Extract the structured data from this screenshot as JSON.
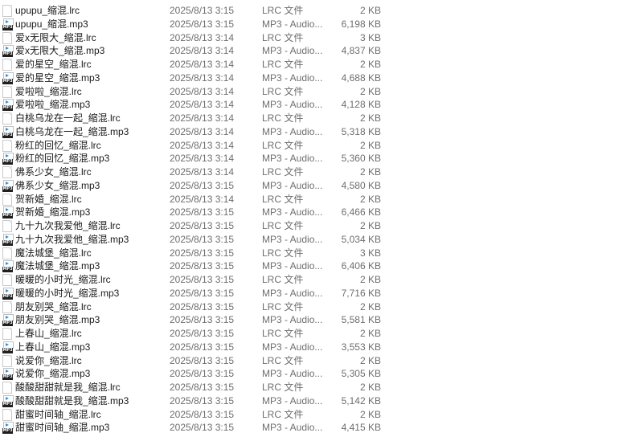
{
  "files": [
    {
      "name": "upupu_缩混.lrc",
      "date": "2025/8/13 3:15",
      "type": "LRC 文件",
      "size": "2 KB",
      "icon": "document-icon"
    },
    {
      "name": "upupu_缩混.mp3",
      "date": "2025/8/13 3:15",
      "type": "MP3 - Audio...",
      "size": "6,198 KB",
      "icon": "mp3-audio-icon"
    },
    {
      "name": "爱x无限大_缩混.lrc",
      "date": "2025/8/13 3:14",
      "type": "LRC 文件",
      "size": "3 KB",
      "icon": "document-icon"
    },
    {
      "name": "爱x无限大_缩混.mp3",
      "date": "2025/8/13 3:14",
      "type": "MP3 - Audio...",
      "size": "4,837 KB",
      "icon": "mp3-audio-icon"
    },
    {
      "name": "爱的星空_缩混.lrc",
      "date": "2025/8/13 3:14",
      "type": "LRC 文件",
      "size": "2 KB",
      "icon": "document-icon"
    },
    {
      "name": "爱的星空_缩混.mp3",
      "date": "2025/8/13 3:14",
      "type": "MP3 - Audio...",
      "size": "4,688 KB",
      "icon": "mp3-audio-icon"
    },
    {
      "name": "爱啦啦_缩混.lrc",
      "date": "2025/8/13 3:14",
      "type": "LRC 文件",
      "size": "2 KB",
      "icon": "document-icon"
    },
    {
      "name": "爱啦啦_缩混.mp3",
      "date": "2025/8/13 3:14",
      "type": "MP3 - Audio...",
      "size": "4,128 KB",
      "icon": "mp3-audio-icon"
    },
    {
      "name": "白桃乌龙在一起_缩混.lrc",
      "date": "2025/8/13 3:14",
      "type": "LRC 文件",
      "size": "2 KB",
      "icon": "document-icon"
    },
    {
      "name": "白桃乌龙在一起_缩混.mp3",
      "date": "2025/8/13 3:14",
      "type": "MP3 - Audio...",
      "size": "5,318 KB",
      "icon": "mp3-audio-icon"
    },
    {
      "name": "粉红的回忆_缩混.lrc",
      "date": "2025/8/13 3:14",
      "type": "LRC 文件",
      "size": "2 KB",
      "icon": "document-icon"
    },
    {
      "name": "粉红的回忆_缩混.mp3",
      "date": "2025/8/13 3:14",
      "type": "MP3 - Audio...",
      "size": "5,360 KB",
      "icon": "mp3-audio-icon"
    },
    {
      "name": "佛系少女_缩混.lrc",
      "date": "2025/8/13 3:14",
      "type": "LRC 文件",
      "size": "2 KB",
      "icon": "document-icon"
    },
    {
      "name": "佛系少女_缩混.mp3",
      "date": "2025/8/13 3:15",
      "type": "MP3 - Audio...",
      "size": "4,580 KB",
      "icon": "mp3-audio-icon"
    },
    {
      "name": "贺新婚_缩混.lrc",
      "date": "2025/8/13 3:14",
      "type": "LRC 文件",
      "size": "2 KB",
      "icon": "document-icon"
    },
    {
      "name": "贺新婚_缩混.mp3",
      "date": "2025/8/13 3:15",
      "type": "MP3 - Audio...",
      "size": "6,466 KB",
      "icon": "mp3-audio-icon"
    },
    {
      "name": "九十九次我爱他_缩混.lrc",
      "date": "2025/8/13 3:15",
      "type": "LRC 文件",
      "size": "2 KB",
      "icon": "document-icon"
    },
    {
      "name": "九十九次我爱他_缩混.mp3",
      "date": "2025/8/13 3:15",
      "type": "MP3 - Audio...",
      "size": "5,034 KB",
      "icon": "mp3-audio-icon"
    },
    {
      "name": "魔法城堡_缩混.lrc",
      "date": "2025/8/13 3:15",
      "type": "LRC 文件",
      "size": "3 KB",
      "icon": "document-icon"
    },
    {
      "name": "魔法城堡_缩混.mp3",
      "date": "2025/8/13 3:15",
      "type": "MP3 - Audio...",
      "size": "6,406 KB",
      "icon": "mp3-audio-icon"
    },
    {
      "name": "暖暖的小时光_缩混.lrc",
      "date": "2025/8/13 3:15",
      "type": "LRC 文件",
      "size": "2 KB",
      "icon": "document-icon"
    },
    {
      "name": "暖暖的小时光_缩混.mp3",
      "date": "2025/8/13 3:15",
      "type": "MP3 - Audio...",
      "size": "7,716 KB",
      "icon": "mp3-audio-icon"
    },
    {
      "name": "朋友别哭_缩混.lrc",
      "date": "2025/8/13 3:15",
      "type": "LRC 文件",
      "size": "2 KB",
      "icon": "document-icon"
    },
    {
      "name": "朋友别哭_缩混.mp3",
      "date": "2025/8/13 3:15",
      "type": "MP3 - Audio...",
      "size": "5,581 KB",
      "icon": "mp3-audio-icon"
    },
    {
      "name": "上春山_缩混.lrc",
      "date": "2025/8/13 3:15",
      "type": "LRC 文件",
      "size": "2 KB",
      "icon": "document-icon"
    },
    {
      "name": "上春山_缩混.mp3",
      "date": "2025/8/13 3:15",
      "type": "MP3 - Audio...",
      "size": "3,553 KB",
      "icon": "mp3-audio-icon"
    },
    {
      "name": "说爱你_缩混.lrc",
      "date": "2025/8/13 3:15",
      "type": "LRC 文件",
      "size": "2 KB",
      "icon": "document-icon"
    },
    {
      "name": "说爱你_缩混.mp3",
      "date": "2025/8/13 3:15",
      "type": "MP3 - Audio...",
      "size": "5,305 KB",
      "icon": "mp3-audio-icon"
    },
    {
      "name": "酸酸甜甜就是我_缩混.lrc",
      "date": "2025/8/13 3:15",
      "type": "LRC 文件",
      "size": "2 KB",
      "icon": "document-icon"
    },
    {
      "name": "酸酸甜甜就是我_缩混.mp3",
      "date": "2025/8/13 3:15",
      "type": "MP3 - Audio...",
      "size": "5,142 KB",
      "icon": "mp3-audio-icon"
    },
    {
      "name": "甜蜜时间轴_缩混.lrc",
      "date": "2025/8/13 3:15",
      "type": "LRC 文件",
      "size": "2 KB",
      "icon": "document-icon"
    },
    {
      "name": "甜蜜时间轴_缩混.mp3",
      "date": "2025/8/13 3:15",
      "type": "MP3 - Audio...",
      "size": "4,415 KB",
      "icon": "mp3-audio-icon"
    }
  ],
  "colors": {
    "play_accent": "#2b8fd6",
    "badge": "#1f1f1f",
    "secondary_text": "#6e6e6e"
  },
  "icon_badge_text": "MP3"
}
